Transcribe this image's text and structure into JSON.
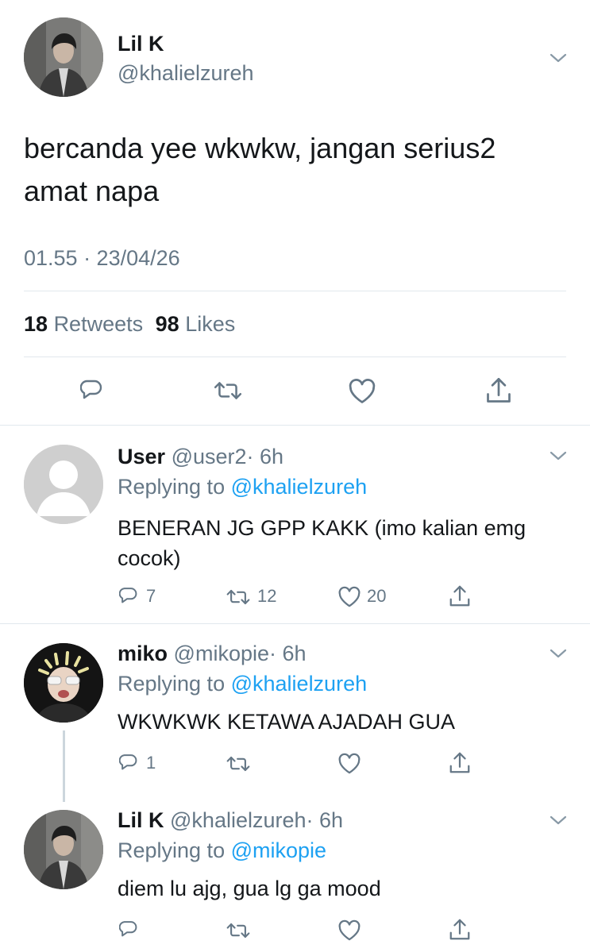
{
  "main_tweet": {
    "author_name": "Lil K",
    "author_handle": "@khalielzureh",
    "text_line1": "bercanda yee wkwkw, jangan serius2",
    "text_line2": "amat napa",
    "timestamp": "01.55 · 23/04/26",
    "retweets_count": "18",
    "retweets_label": "Retweets",
    "likes_count": "98",
    "likes_label": "Likes"
  },
  "replies": [
    {
      "name": "User",
      "handle": "@user2",
      "time": "· 6h",
      "replying_prefix": "Replying to",
      "replying_to": "@khalielzureh",
      "text_line1": "BENERAN JG GPP KAKK (imo kalian emg",
      "text_line2": "cocok)",
      "reply_count": "7",
      "retweet_count": "12",
      "like_count": "20"
    },
    {
      "name": "miko",
      "handle": "@mikopie",
      "time": "· 6h",
      "replying_prefix": "Replying to",
      "replying_to": "@khalielzureh",
      "text_line1": "WKWKWK KETAWA AJADAH GUA",
      "reply_count": "1"
    },
    {
      "name": "Lil K",
      "handle": "@khalielzureh",
      "time": "· 6h",
      "replying_prefix": "Replying to",
      "replying_to": "@mikopie",
      "text_line1": "diem lu ajg, gua lg ga mood"
    }
  ],
  "colors": {
    "link": "#1da1f2",
    "muted": "#657786",
    "divider": "#e1e8ed"
  }
}
